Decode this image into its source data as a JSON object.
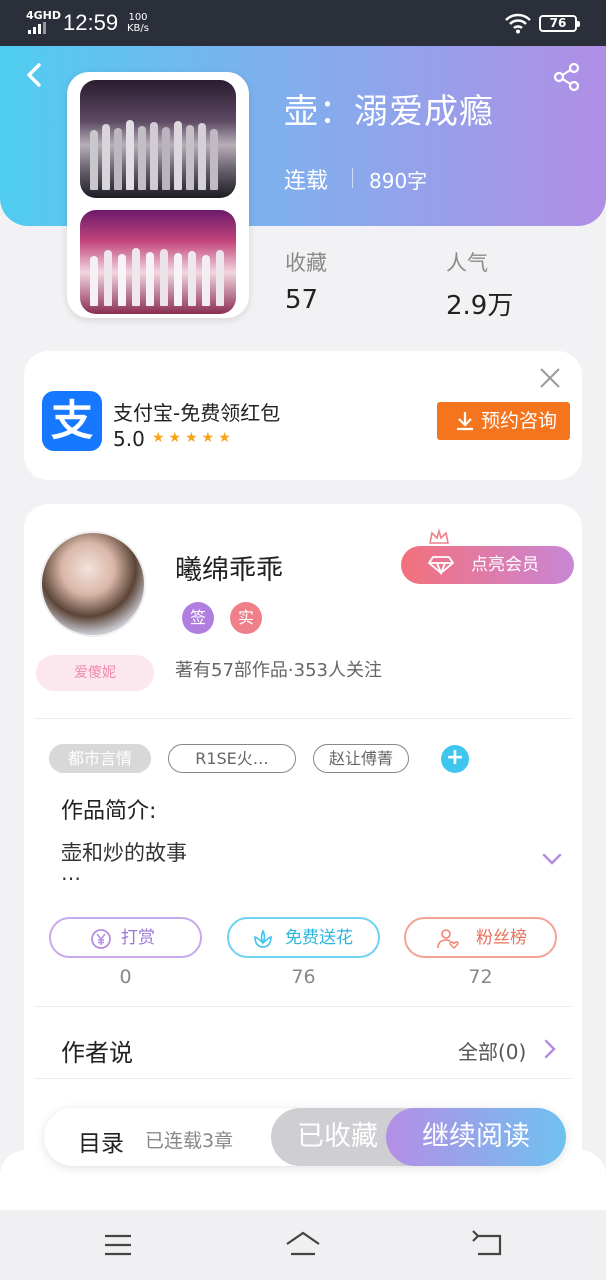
{
  "status_bar": {
    "network": "4GHD",
    "time": "12:59",
    "speed_value": "100",
    "speed_unit": "KB/s",
    "battery": "76"
  },
  "book": {
    "title": "壶：溺爱成瘾",
    "status": "连载",
    "word_count": "890字",
    "stats": [
      {
        "label": "收藏",
        "value": "57"
      },
      {
        "label": "人气",
        "value": "2.9万"
      }
    ]
  },
  "ad": {
    "title": "支付宝-免费领红包",
    "rating": "5.0",
    "stars": "★★★★★",
    "icon_glyph": "支",
    "button_label": "预约咨询"
  },
  "author": {
    "name": "曦绵乖乖",
    "badges": [
      {
        "text": "签",
        "color": "#b07fe0"
      },
      {
        "text": "实",
        "color": "#f07f8a"
      }
    ],
    "frame_label": "爱傻妮",
    "meta": "著有57部作品·353人关注",
    "vip_label": "点亮会员"
  },
  "tags": [
    "都市言情",
    "R1SE火…",
    "赵让傅菁"
  ],
  "add_tag": "+",
  "intro": {
    "label": "作品简介:",
    "text": "壶和炒的故事",
    "more": "…"
  },
  "actions": [
    {
      "label": "打赏",
      "count": "0",
      "color": "#b58ee0"
    },
    {
      "label": "免费送花",
      "count": "76",
      "color": "#3fc6ef"
    },
    {
      "label": "粉丝榜",
      "count": "72",
      "color": "#f0826f"
    }
  ],
  "author_say": {
    "label": "作者说",
    "all": "全部(0)"
  },
  "read_bar": {
    "toc": "目录",
    "toc_sub": "已连载3章",
    "collected": "已收藏",
    "continue": "继续阅读"
  },
  "colors": {
    "header_start": "#4fcdf0",
    "header_end": "#b08fe6",
    "alipay": "#1677ff",
    "ad_button": "#f5751f"
  }
}
